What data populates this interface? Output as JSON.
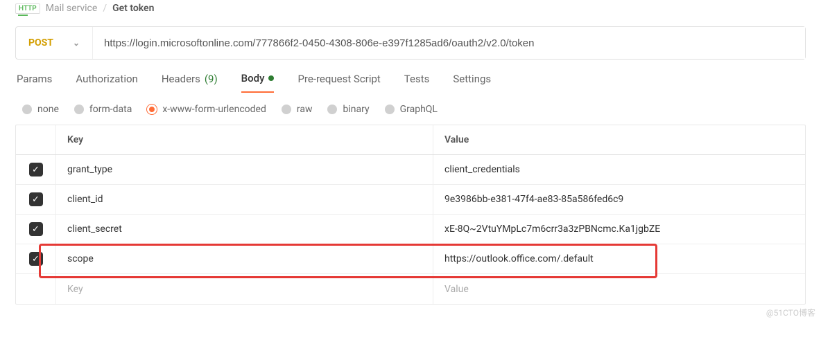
{
  "breadcrumb": {
    "badge": "HTTP",
    "parent": "Mail service",
    "current": "Get token"
  },
  "request": {
    "method": "POST",
    "url": "https://login.microsoftonline.com/777866f2-0450-4308-806e-e397f1285ad6/oauth2/v2.0/token"
  },
  "tabs": {
    "params": "Params",
    "authorization": "Authorization",
    "headers": "Headers",
    "headers_count": "(9)",
    "body": "Body",
    "prerequest": "Pre-request Script",
    "tests": "Tests",
    "settings": "Settings"
  },
  "body_types": {
    "none": "none",
    "formdata": "form-data",
    "urlencoded": "x-www-form-urlencoded",
    "raw": "raw",
    "binary": "binary",
    "graphql": "GraphQL"
  },
  "table": {
    "key_header": "Key",
    "value_header": "Value",
    "rows": [
      {
        "key": "grant_type",
        "value": "client_credentials"
      },
      {
        "key": "client_id",
        "value": "9e3986bb-e381-47f4-ae83-85a586fed6c9"
      },
      {
        "key": "client_secret",
        "value": "xE-8Q~2VtuYMpLc7m6crr3a3zPBNcmc.Ka1jgbZE"
      },
      {
        "key": "scope",
        "value": "https://outlook.office.com/.default"
      }
    ],
    "placeholder_key": "Key",
    "placeholder_value": "Value"
  },
  "watermark": "@51CTO博客"
}
